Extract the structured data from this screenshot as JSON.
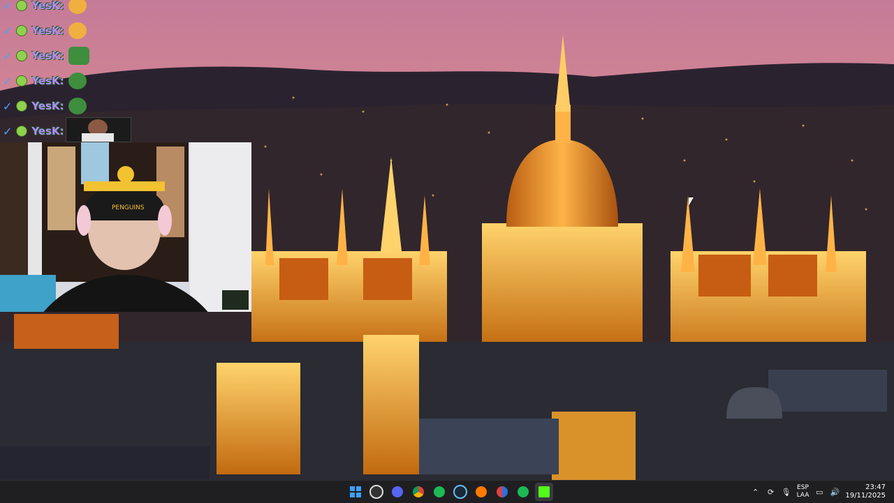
{
  "chat": {
    "messages": [
      {
        "user": "YesK:",
        "emote": "emoji-emote"
      },
      {
        "user": "YesK:",
        "emote": "emoji-emote"
      },
      {
        "user": "YesK:",
        "emote": "pepe-emote"
      },
      {
        "user": "YesK:",
        "emote": "pepe-emote"
      },
      {
        "user": "YesK:",
        "emote": "pepe-emote"
      },
      {
        "user": "YesK:",
        "emote": "clip-thumbnail"
      }
    ]
  },
  "webcam": {
    "beanie_text": "PENGUINS"
  },
  "taskbar": {
    "apps": [
      {
        "name": "start",
        "color": "#3aa0ff"
      },
      {
        "name": "obs",
        "color": "#e64545"
      },
      {
        "name": "discord",
        "color": "#5865f2"
      },
      {
        "name": "chrome",
        "color": "#f4b400"
      },
      {
        "name": "spotify",
        "color": "#1db954"
      },
      {
        "name": "steam",
        "color": "#66c0f4"
      },
      {
        "name": "app-orange",
        "color": "#ff7a00"
      },
      {
        "name": "app-redblue",
        "color": "#e04040"
      },
      {
        "name": "spotify-2",
        "color": "#1db954"
      },
      {
        "name": "kick",
        "color": "#53fc18"
      }
    ],
    "language": {
      "top": "ESP",
      "bottom": "LAA"
    },
    "time": "23:47",
    "date": "19/11/2025"
  },
  "colors": {
    "sky_top": "#e79a8c",
    "sky_mid": "#c27c93",
    "building_gold": "#ffb000",
    "taskbar": "#1f1f22"
  }
}
